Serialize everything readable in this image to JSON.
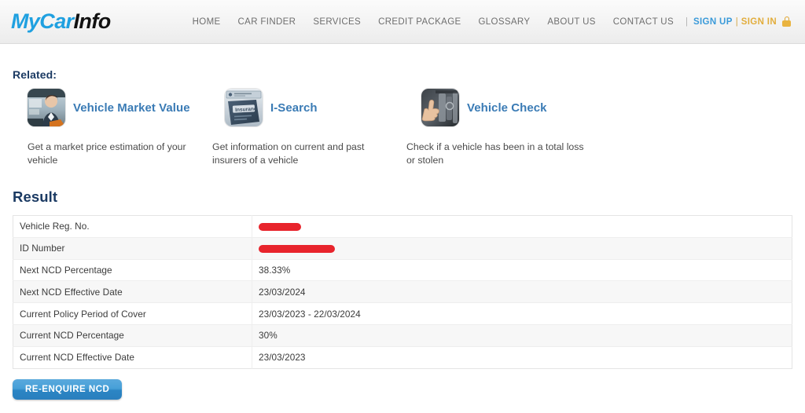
{
  "header": {
    "logo": {
      "part_blue": "MyCar",
      "part_dark": "Info"
    },
    "nav": [
      {
        "label": "HOME",
        "name": "nav-home"
      },
      {
        "label": "CAR FINDER",
        "name": "nav-car-finder"
      },
      {
        "label": "SERVICES",
        "name": "nav-services"
      },
      {
        "label": "CREDIT PACKAGE",
        "name": "nav-credit-package"
      },
      {
        "label": "GLOSSARY",
        "name": "nav-glossary"
      },
      {
        "label": "ABOUT US",
        "name": "nav-about-us"
      },
      {
        "label": "CONTACT US",
        "name": "nav-contact-us"
      }
    ],
    "separator": "|",
    "sign_up": "SIGN UP",
    "pipe": "|",
    "sign_in": "SIGN IN",
    "lock_icon": "lock-icon",
    "colors": {
      "sign_up": "#3a9ad9",
      "sign_in": "#e2ad3c",
      "logo_blue": "#1fa0e0"
    }
  },
  "related": {
    "heading": "Related:",
    "items": [
      {
        "icon": "businessperson-photo-icon",
        "link": "Vehicle Market Value",
        "desc": "Get a market price estimation of your vehicle"
      },
      {
        "icon": "insurance-document-icon",
        "link": "I-Search",
        "desc": "Get information on current and past insurers of a vehicle"
      },
      {
        "icon": "thumbs-up-engine-icon",
        "link": "Vehicle Check",
        "desc": "Check if a vehicle has been in a total loss or stolen"
      }
    ]
  },
  "result": {
    "heading": "Result",
    "rows": [
      {
        "label": "Vehicle Reg. No.",
        "value": "",
        "redacted": true,
        "redact_width": 54
      },
      {
        "label": "ID Number",
        "value": "",
        "redacted": true,
        "redact_width": 97
      },
      {
        "label": "Next NCD Percentage",
        "value": "38.33%",
        "redacted": false
      },
      {
        "label": "Next NCD Effective Date",
        "value": "23/03/2024",
        "redacted": false
      },
      {
        "label": "Current Policy Period of Cover",
        "value": "23/03/2023 - 22/03/2024",
        "redacted": false
      },
      {
        "label": "Current NCD Percentage",
        "value": "30%",
        "redacted": false
      },
      {
        "label": "Current NCD Effective Date",
        "value": "23/03/2023",
        "redacted": false
      }
    ],
    "redaction_color": "#e8242c"
  },
  "actions": {
    "reenquire_label": "RE-ENQUIRE NCD"
  }
}
